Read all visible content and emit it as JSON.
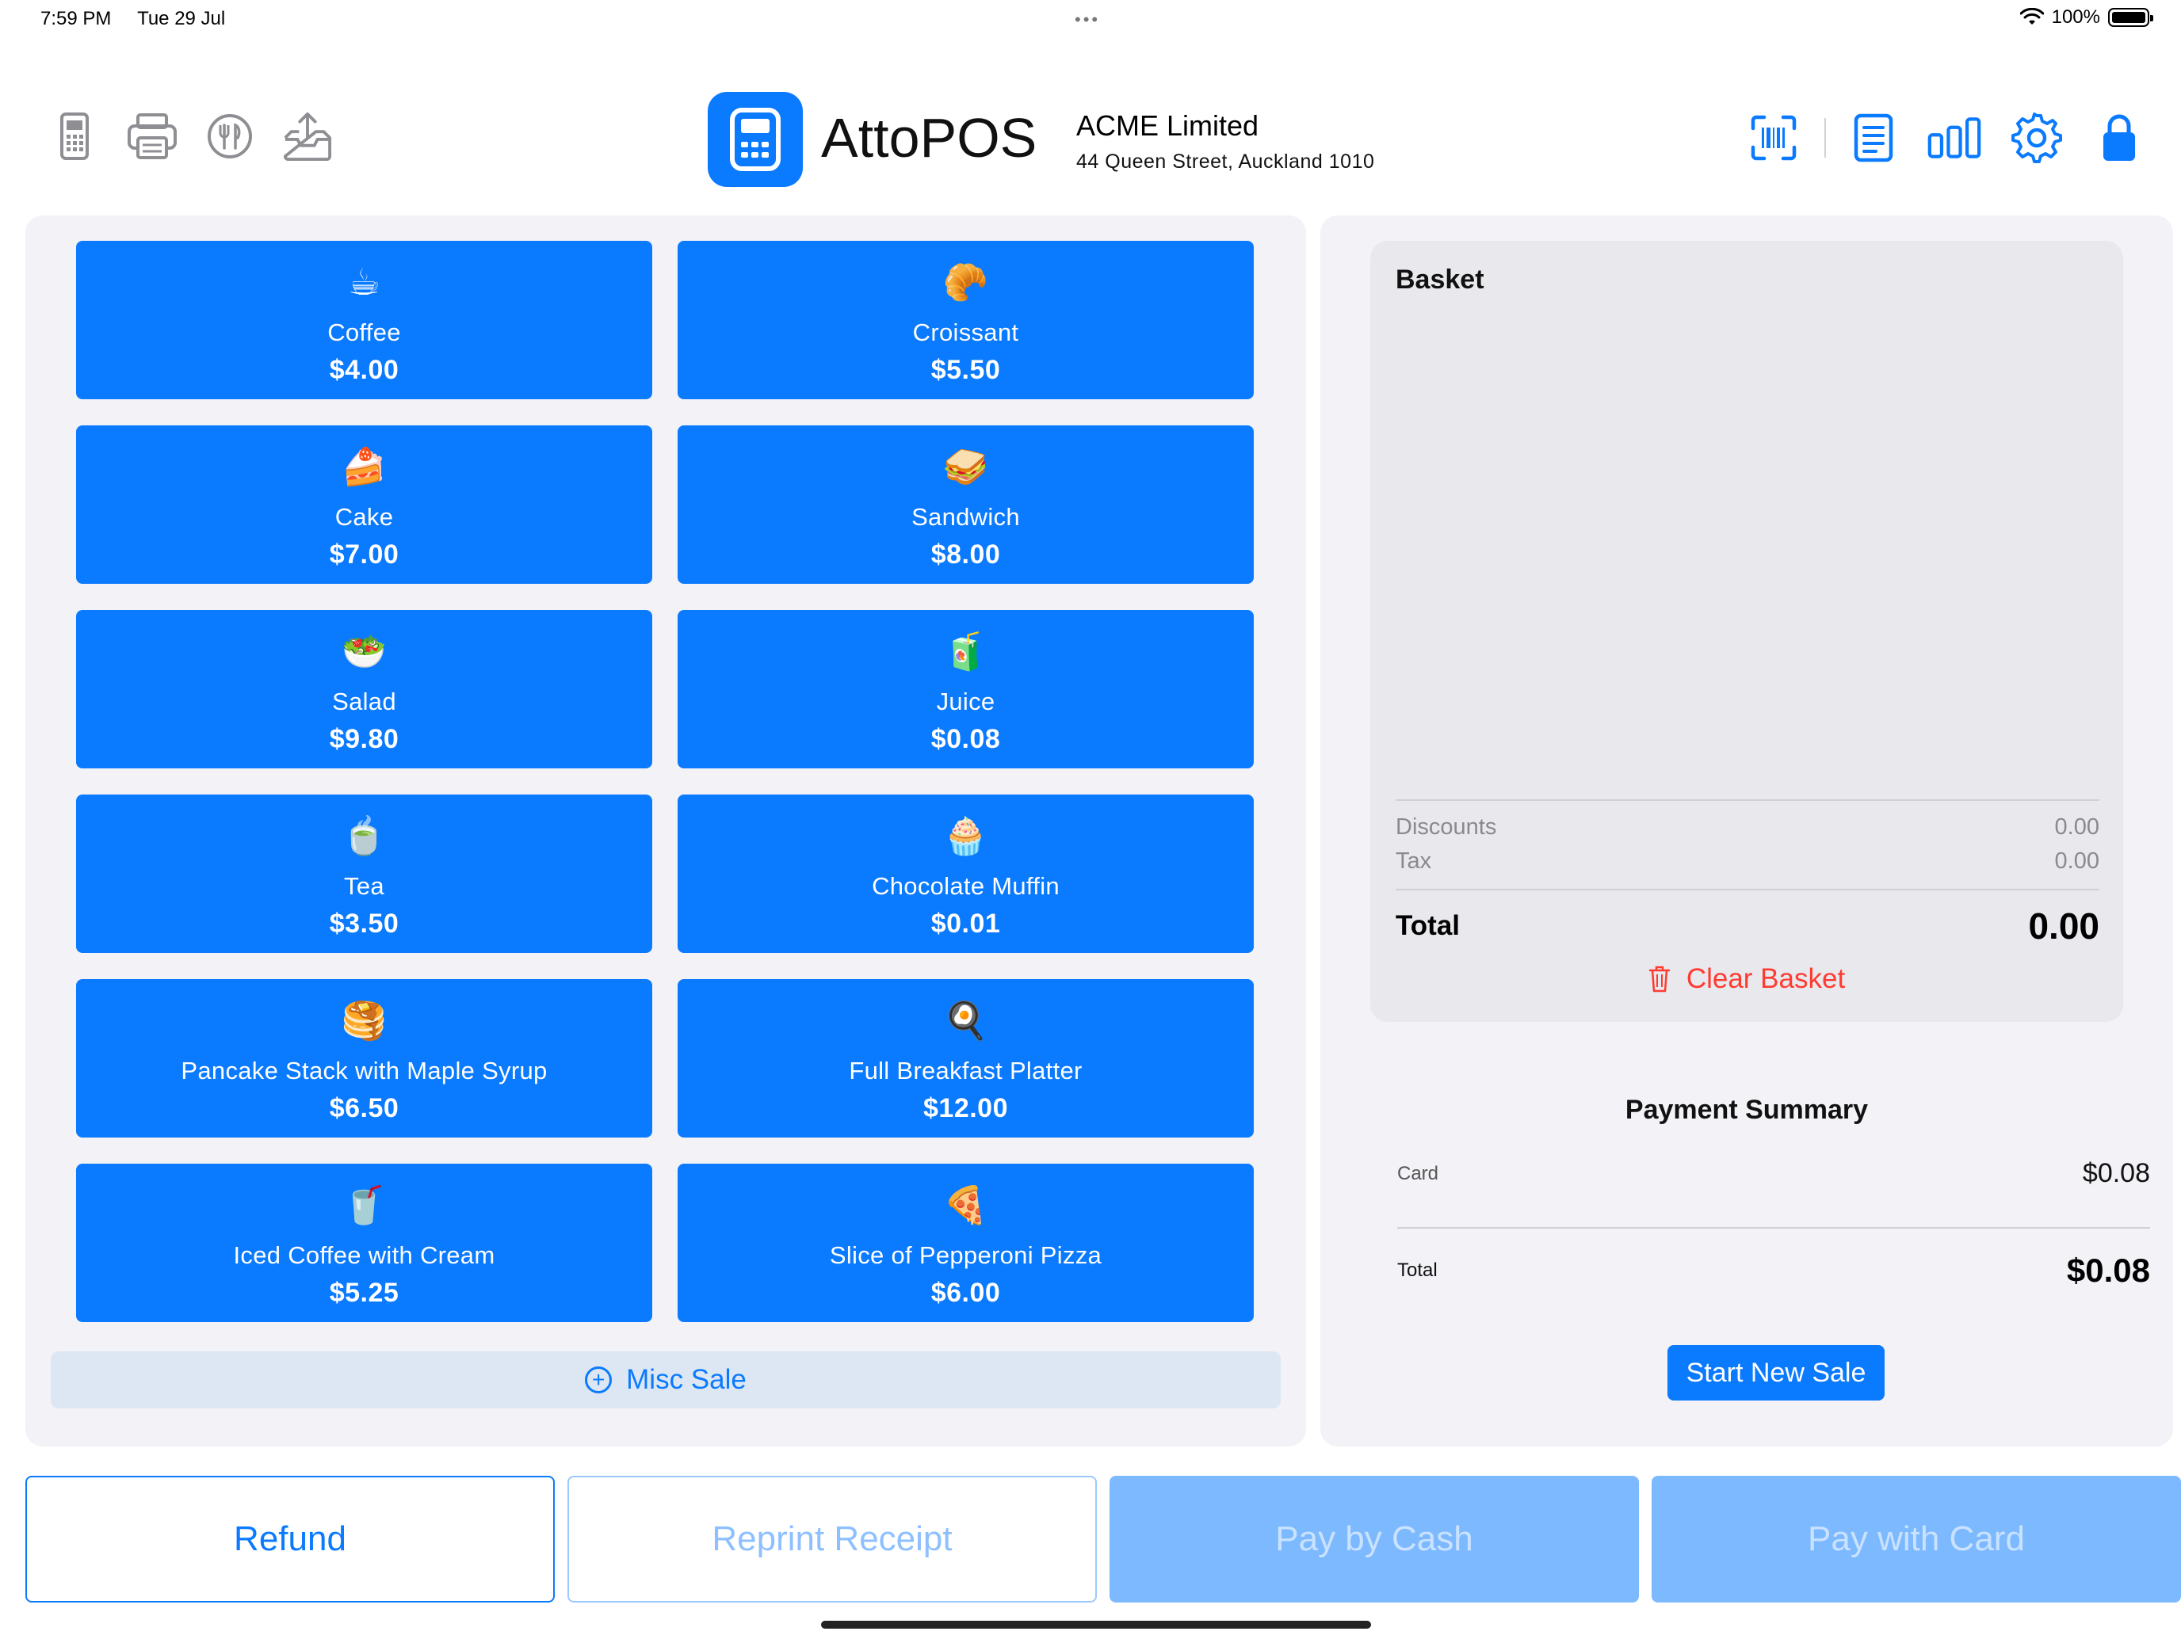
{
  "status_bar": {
    "time": "7:59 PM",
    "date": "Tue 29 Jul",
    "battery": "100%"
  },
  "header": {
    "app_name": "AttoPOS",
    "company_name": "ACME Limited",
    "company_address": "44 Queen Street, Auckland 1010",
    "left_icons": [
      "card-terminal-icon",
      "printer-icon",
      "restaurant-icon",
      "export-icon"
    ],
    "right_icons": [
      "barcode-scan-icon",
      "notes-icon",
      "chart-icon",
      "settings-icon",
      "lock-icon"
    ]
  },
  "products": [
    {
      "emoji": "☕",
      "name": "Coffee",
      "price": "$4.00"
    },
    {
      "emoji": "🥐",
      "name": "Croissant",
      "price": "$5.50"
    },
    {
      "emoji": "🍰",
      "name": "Cake",
      "price": "$7.00"
    },
    {
      "emoji": "🥪",
      "name": "Sandwich",
      "price": "$8.00"
    },
    {
      "emoji": "🥗",
      "name": "Salad",
      "price": "$9.80"
    },
    {
      "emoji": "🧃",
      "name": "Juice",
      "price": "$0.08"
    },
    {
      "emoji": "🍵",
      "name": "Tea",
      "price": "$3.50"
    },
    {
      "emoji": "🧁",
      "name": "Chocolate Muffin",
      "price": "$0.01"
    },
    {
      "emoji": "🥞",
      "name": "Pancake Stack with Maple Syrup",
      "price": "$6.50"
    },
    {
      "emoji": "🍳",
      "name": "Full Breakfast Platter",
      "price": "$12.00"
    },
    {
      "emoji": "🥤",
      "name": "Iced Coffee with Cream",
      "price": "$5.25"
    },
    {
      "emoji": "🍕",
      "name": "Slice of Pepperoni Pizza",
      "price": "$6.00"
    }
  ],
  "misc_sale_label": "Misc Sale",
  "basket": {
    "title": "Basket",
    "discounts_label": "Discounts",
    "discounts_value": "0.00",
    "tax_label": "Tax",
    "tax_value": "0.00",
    "total_label": "Total",
    "total_value": "0.00",
    "clear_label": "Clear Basket"
  },
  "payment_summary": {
    "title": "Payment Summary",
    "card_label": "Card",
    "card_value": "$0.08",
    "total_label": "Total",
    "total_value": "$0.08",
    "start_new_label": "Start New Sale"
  },
  "bottom_buttons": {
    "refund": "Refund",
    "reprint": "Reprint Receipt",
    "pay_cash": "Pay by Cash",
    "pay_card": "Pay with Card"
  },
  "colors": {
    "accent": "#0a7aff",
    "destructive": "#ff3b30",
    "panel_bg": "#f2f2f7",
    "disabled_button": "#7db9ff"
  }
}
